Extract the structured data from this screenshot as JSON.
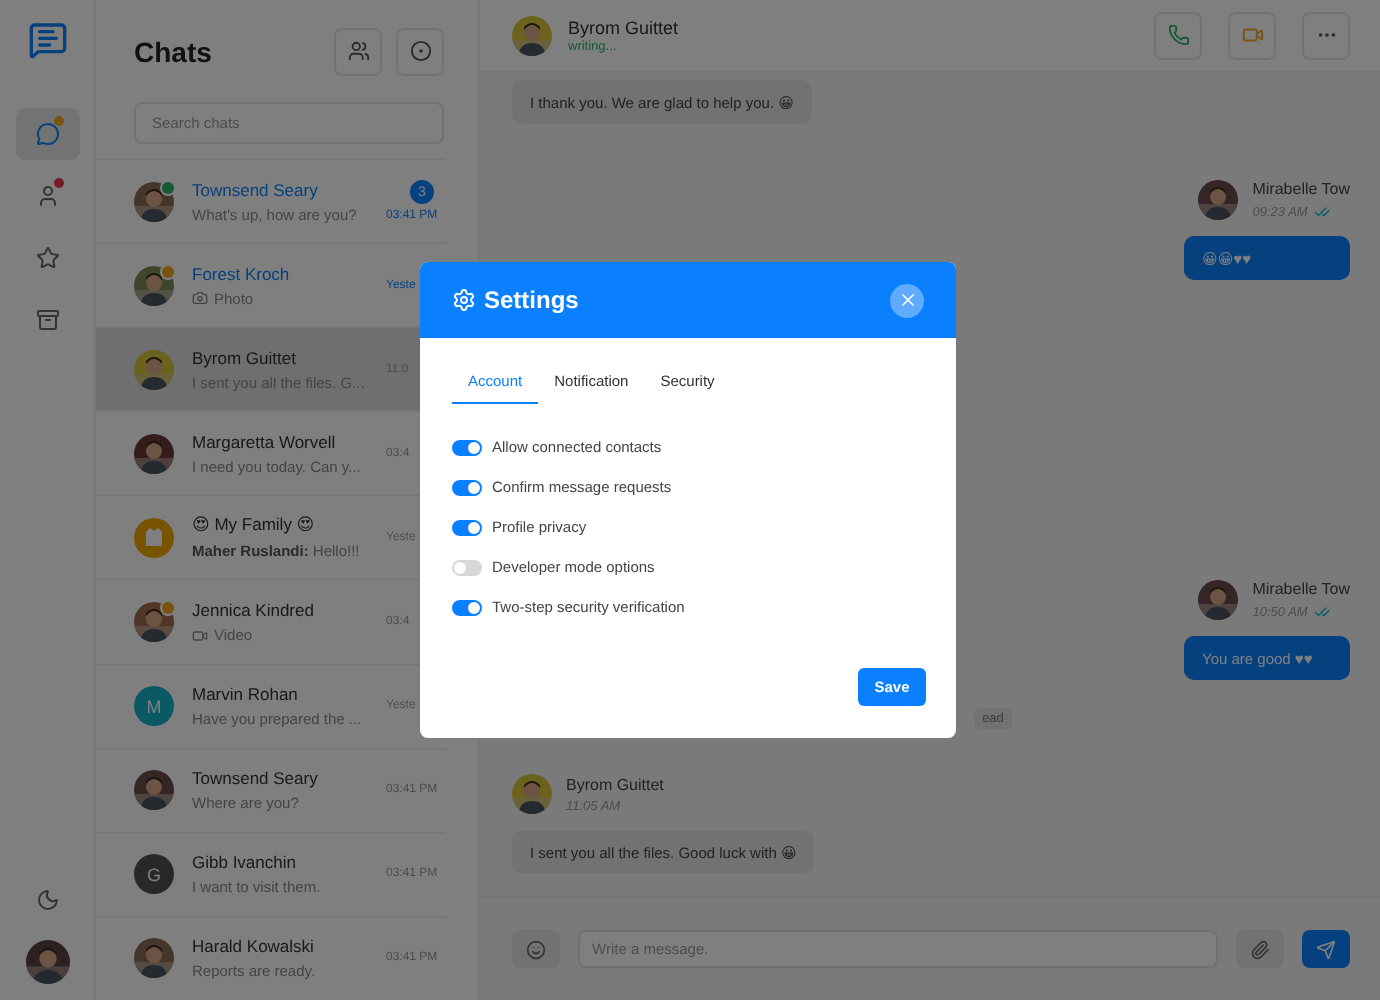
{
  "rail": {
    "items": [
      {
        "kind": "chats",
        "selected": true,
        "color": "#7a5311"
      },
      {
        "kind": "contacts",
        "selected": false,
        "color": "#741b27"
      },
      {
        "kind": "favorites",
        "selected": false
      },
      {
        "kind": "archive",
        "selected": false
      }
    ],
    "bottom": [
      {
        "kind": "theme"
      },
      {
        "kind": "profile"
      }
    ]
  },
  "chat_list": {
    "title": "Chats",
    "search": {
      "placeholder": "Search chats"
    },
    "chats": [
      {
        "kind": "text",
        "name": "Townsend Seary",
        "preview": "What's up, how are you?",
        "time": "03:41 PM",
        "badge": "3",
        "unread": true,
        "selected": false,
        "color": "#175935"
      },
      {
        "name": "Forest Kroch",
        "preview": "Photo",
        "time": "Yeste",
        "unread": true,
        "selected": false,
        "color": "#7a5311"
      },
      {
        "kind": "text",
        "name": "Byrom Guittet",
        "preview": "I sent you all the files. G...",
        "time": "11:0",
        "unread": false,
        "selected": true
      },
      {
        "kind": "text",
        "name": "Margaretta Worvell",
        "preview": "I need you today. Can y...",
        "time": "03:4",
        "unread": false,
        "selected": false
      },
      {
        "kind": "text",
        "name": "😍 My Family 😍",
        "preview": "**Maher Ruslandi:** Hello!!!",
        "time": "Yeste",
        "unread": false,
        "selected": false,
        "avatar": {
          "kind": "group",
          "color": "#785400"
        }
      },
      {
        "kind": "video",
        "name": "Jennica Kindred",
        "preview": "Video",
        "time": "03:4",
        "unread": false,
        "selected": false,
        "color": "#7a5311"
      },
      {
        "kind": "text",
        "name": "Marvin Rohan",
        "preview": "Have you prepared the ...",
        "time": "Yeste",
        "unread": false,
        "selected": false,
        "avatar": {
          "kind": "letter",
          "letter": "M",
          "color": "#095a64"
        }
      },
      {
        "kind": "text",
        "name": "Townsend Seary",
        "preview": "Where are you?",
        "time": "03:41 PM",
        "unread": false,
        "selected": false
      },
      {
        "kind": "text",
        "name": "Gibb Ivanchin",
        "preview": "I want to visit them.",
        "time": "03:41 PM",
        "unread": false,
        "selected": false,
        "avatar": {
          "kind": "letter",
          "letter": "G",
          "color": "#282828"
        }
      },
      {
        "kind": "text",
        "name": "Harald Kowalski",
        "preview": "Reports are ready.",
        "time": "03:41 PM",
        "unread": false,
        "selected": false
      }
    ]
  },
  "conversation": {
    "header": {
      "name": "Byrom Guittet",
      "status": "writing..."
    },
    "actions": [
      {
        "kind": "call"
      },
      {
        "kind": "video"
      },
      {
        "kind": "more"
      }
    ],
    "messages": [
      {
        "kind": "incoming",
        "text": "I thank you. We are glad to help you. 😀"
      },
      {
        "kind": "outgoing",
        "sender": "Mirabelle Tow",
        "time": "09:23 AM",
        "read": true,
        "text": "😀😀♥♥"
      },
      {
        "kind": "outgoing",
        "sender": "Mirabelle Tow",
        "time": "10:50 AM",
        "read": true,
        "text": "You are good ♥♥"
      },
      {
        "kind": "divider",
        "text": "ead"
      },
      {
        "kind": "incoming",
        "sender": "Byrom Guittet",
        "time": "11:05 AM",
        "text": "I sent you all the files. Good luck with 😀"
      }
    ],
    "composer": {
      "placeholder": "Write a message."
    }
  },
  "settings": {
    "title": "Settings",
    "tabs": [
      {
        "label": "Account",
        "selected": true
      },
      {
        "label": "Notification",
        "selected": false
      },
      {
        "label": "Security",
        "selected": false
      }
    ],
    "options": [
      {
        "label": "Allow connected contacts",
        "on": true
      },
      {
        "label": "Confirm message requests",
        "on": true
      },
      {
        "label": "Profile privacy",
        "on": true
      },
      {
        "label": "Developer mode options",
        "on": false
      },
      {
        "label": "Two-step security verification",
        "on": true
      }
    ],
    "save": "Save"
  }
}
